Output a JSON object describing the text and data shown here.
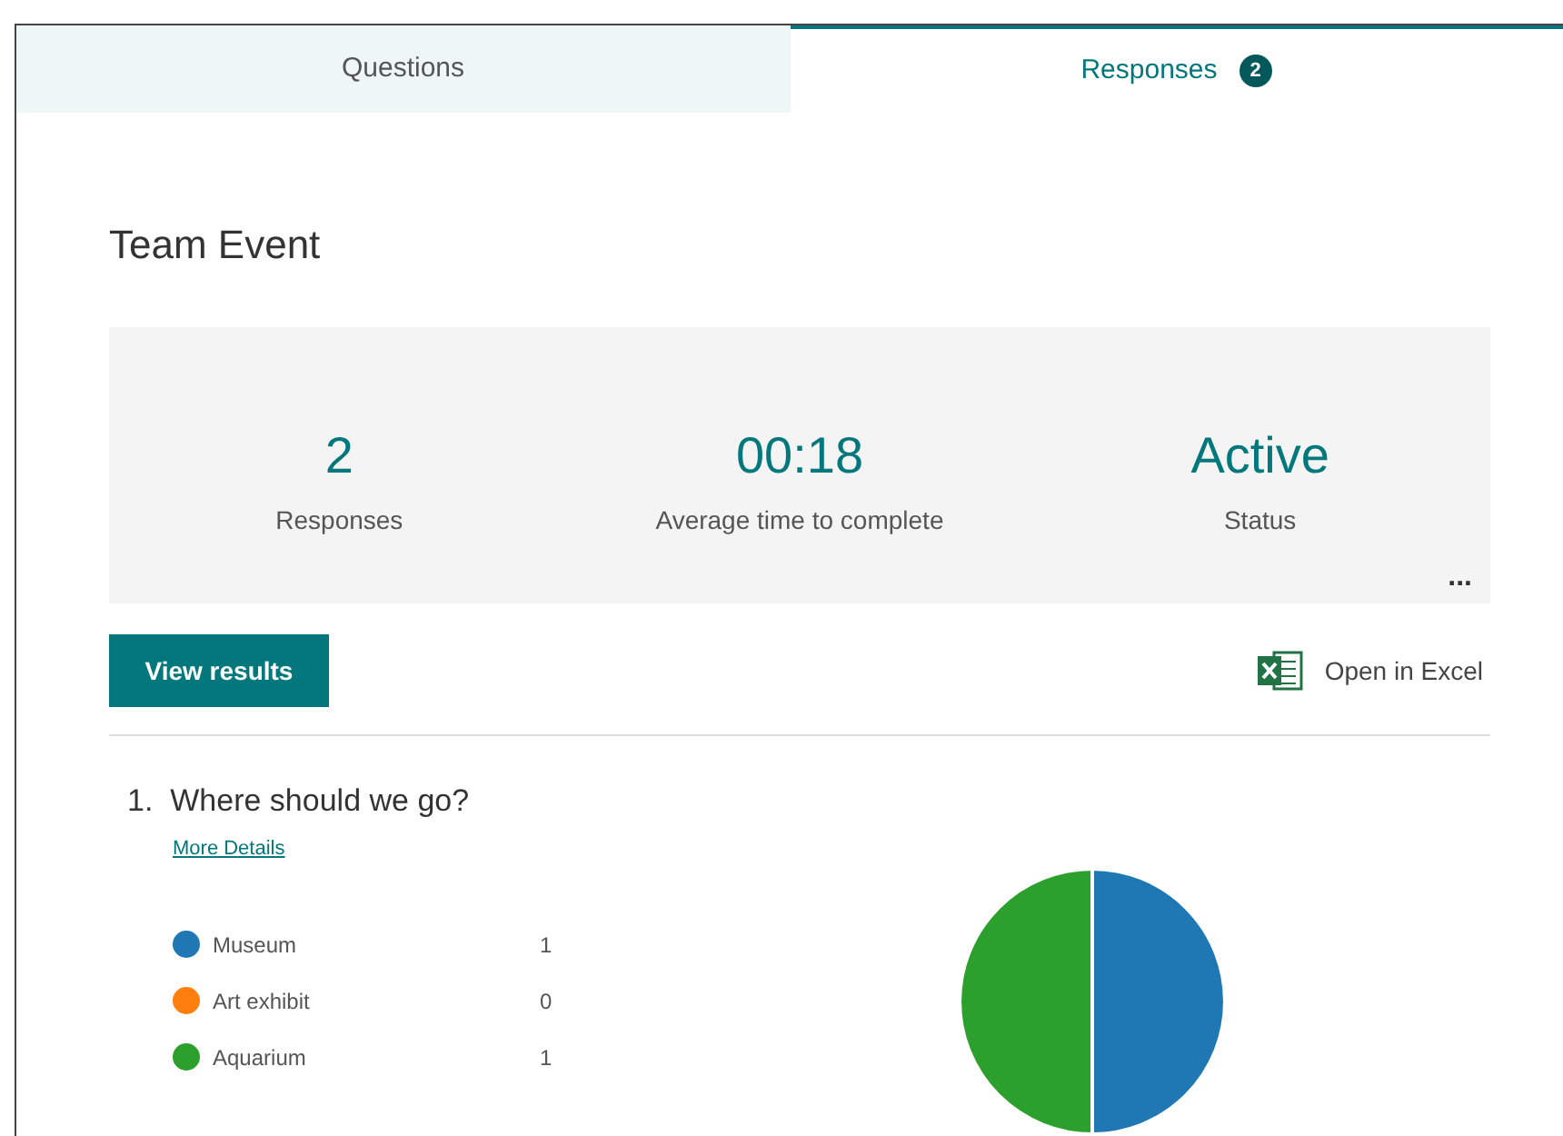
{
  "tabs": [
    {
      "label": "Questions",
      "selected": false
    },
    {
      "label": "Responses",
      "selected": true,
      "badge": "2"
    }
  ],
  "form_title": "Team Event",
  "stats": [
    {
      "value": "2",
      "label": "Responses"
    },
    {
      "value": "00:18",
      "label": "Average time to complete"
    },
    {
      "value": "Active",
      "label": "Status"
    }
  ],
  "more_menu": "...",
  "view_results_button": "View results",
  "open_in_excel": "Open in Excel",
  "question": {
    "number": "1.",
    "text": "Where should we go?",
    "more_details": "More Details",
    "legend": [
      {
        "label": "Museum",
        "count": "1",
        "color": "#1f77b4"
      },
      {
        "label": "Art exhibit",
        "count": "0",
        "color": "#ff7f0e"
      },
      {
        "label": "Aquarium",
        "count": "1",
        "color": "#2ca02c"
      }
    ],
    "chart": {
      "kind": "pie"
    }
  }
}
